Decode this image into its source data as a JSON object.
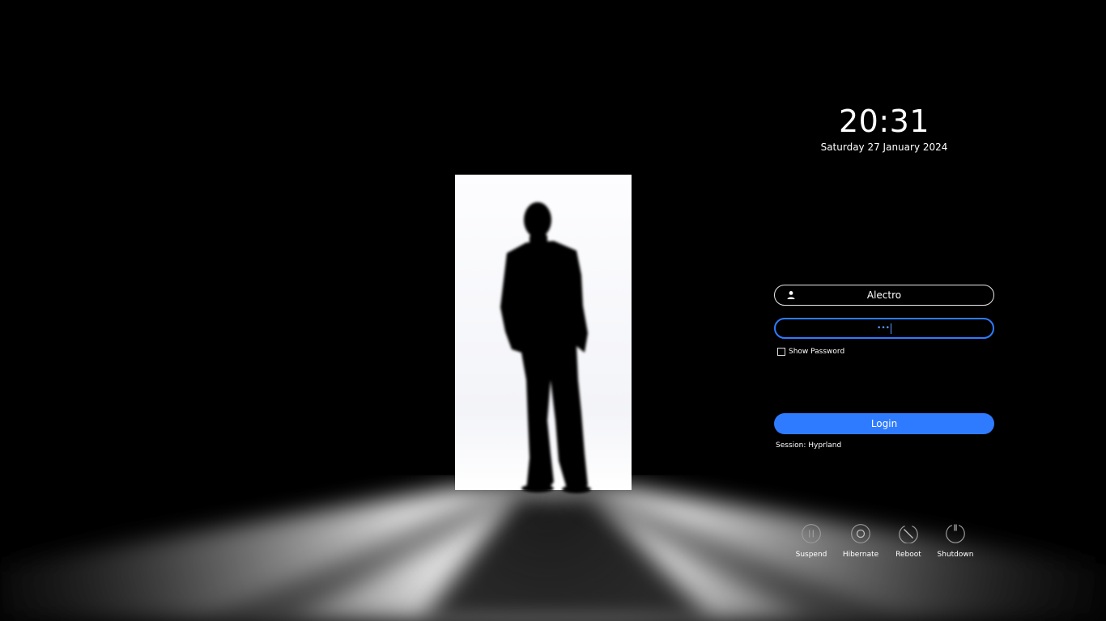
{
  "clock": {
    "time": "20:31",
    "date": "Saturday 27 January 2024"
  },
  "login": {
    "username": "Alectro",
    "password_masked": "•••",
    "show_password_label": "Show Password",
    "show_password_checked": false,
    "login_label": "Login",
    "session_text": "Session: Hyprland"
  },
  "power": [
    {
      "label": "Suspend",
      "icon": "pause-circle-icon"
    },
    {
      "label": "Hibernate",
      "icon": "ring-circle-icon"
    },
    {
      "label": "Reboot",
      "icon": "reboot-icon"
    },
    {
      "label": "Shutdown",
      "icon": "power-icon"
    }
  ],
  "colors": {
    "accent": "#2f7bff",
    "background": "#000000",
    "text": "#ffffff"
  }
}
